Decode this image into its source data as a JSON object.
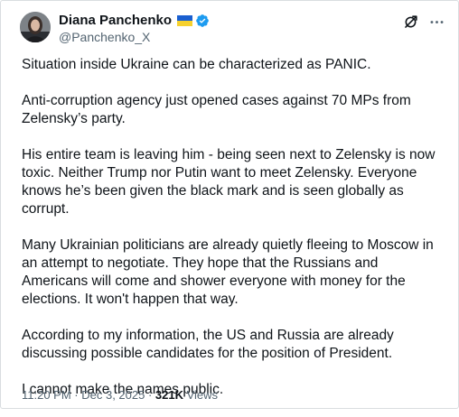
{
  "author": {
    "name": "Diana Panchenko",
    "handle": "@Panchenko_X",
    "flag_icon": "ukraine-flag-icon",
    "verified_icon": "verified-badge-icon",
    "verified_color": "#1d9bf0"
  },
  "header_actions": [
    {
      "icon": "grok-icon"
    },
    {
      "icon": "more-options-icon"
    }
  ],
  "post": {
    "paragraphs": [
      "Situation inside Ukraine can be characterized as PANIC.",
      "Anti-corruption agency just opened cases against 70 MPs from Zelensky’s party.",
      "His entire team is leaving him - being seen next to Zelensky is now toxic. Neither Trump nor Putin want to meet Zelensky. Everyone knows he’s been given the black mark and is seen globally as corrupt.",
      "Many Ukrainian politicians are already quietly fleeing to Moscow in an attempt to negotiate. They hope that the Russians and Americans will come and shower everyone with money for the elections. It won't happen that way.",
      "According to my information, the US and Russia are already discussing possible candidates for the position of President.",
      "I cannot make the names public."
    ]
  },
  "meta": {
    "time": "11:20 PM",
    "separator": " · ",
    "date": "Dec 3, 2025",
    "views_count": "321K",
    "views_label": " Views"
  },
  "colors": {
    "text": "#0f1419",
    "secondary": "#536471",
    "border": "#d9dde0"
  }
}
